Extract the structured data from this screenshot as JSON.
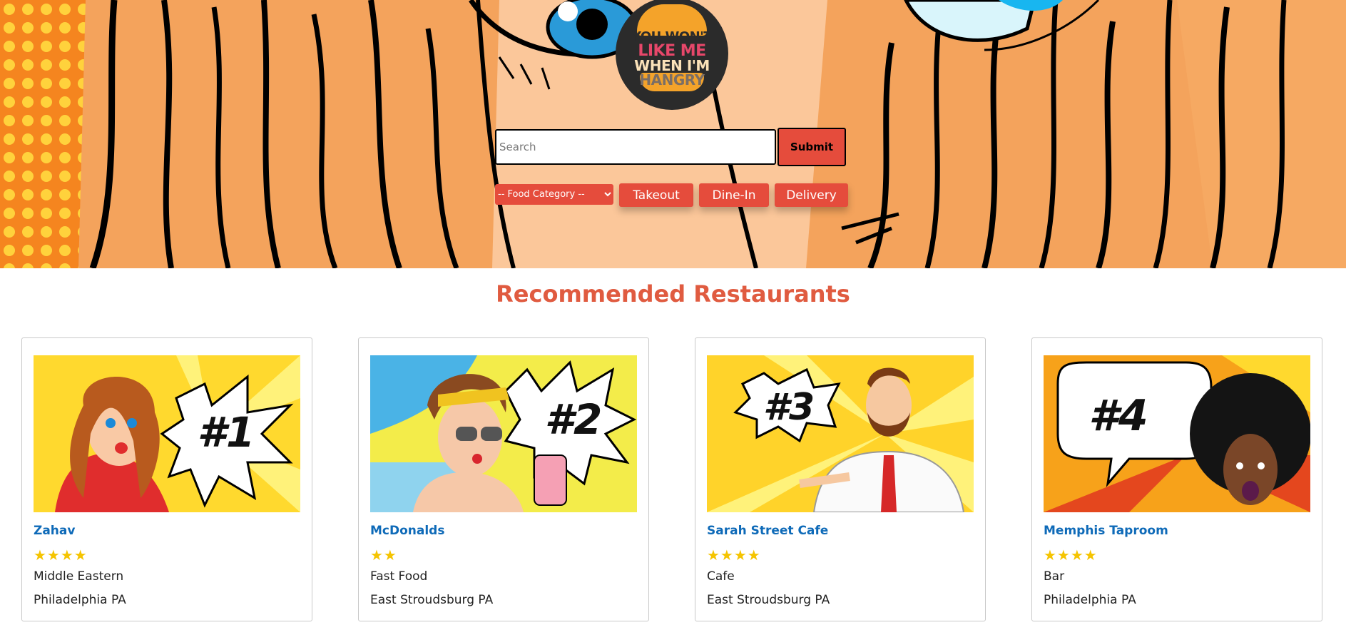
{
  "hero": {
    "logo_lines": [
      "YOU WON'T",
      "LIKE ME",
      "WHEN I'M",
      "HANGRY"
    ]
  },
  "search": {
    "placeholder": "Search",
    "value": "",
    "submit_label": "Submit"
  },
  "filters": {
    "category_selected": "-- Food Category --",
    "buttons": [
      "Takeout",
      "Dine-In",
      "Delivery"
    ]
  },
  "section_title": "Recommended Restaurants",
  "restaurants": [
    {
      "name": "Zahav",
      "rating": 4,
      "stars": "★★★★",
      "cuisine": "Middle Eastern",
      "location": "Philadelphia PA",
      "badge": "#1"
    },
    {
      "name": "McDonalds",
      "rating": 2,
      "stars": "★★",
      "cuisine": "Fast Food",
      "location": "East Stroudsburg PA",
      "badge": "#2"
    },
    {
      "name": "Sarah Street Cafe",
      "rating": 4,
      "stars": "★★★★",
      "cuisine": "Cafe",
      "location": "East Stroudsburg PA",
      "badge": "#3"
    },
    {
      "name": "Memphis Taproom",
      "rating": 4,
      "stars": "★★★★",
      "cuisine": "Bar",
      "location": "Philadelphia PA",
      "badge": "#4"
    }
  ],
  "colors": {
    "accent_red": "#e54c3c",
    "title_orange": "#e05b40",
    "link_blue": "#0e6ab8",
    "star_yellow": "#f5c400"
  }
}
